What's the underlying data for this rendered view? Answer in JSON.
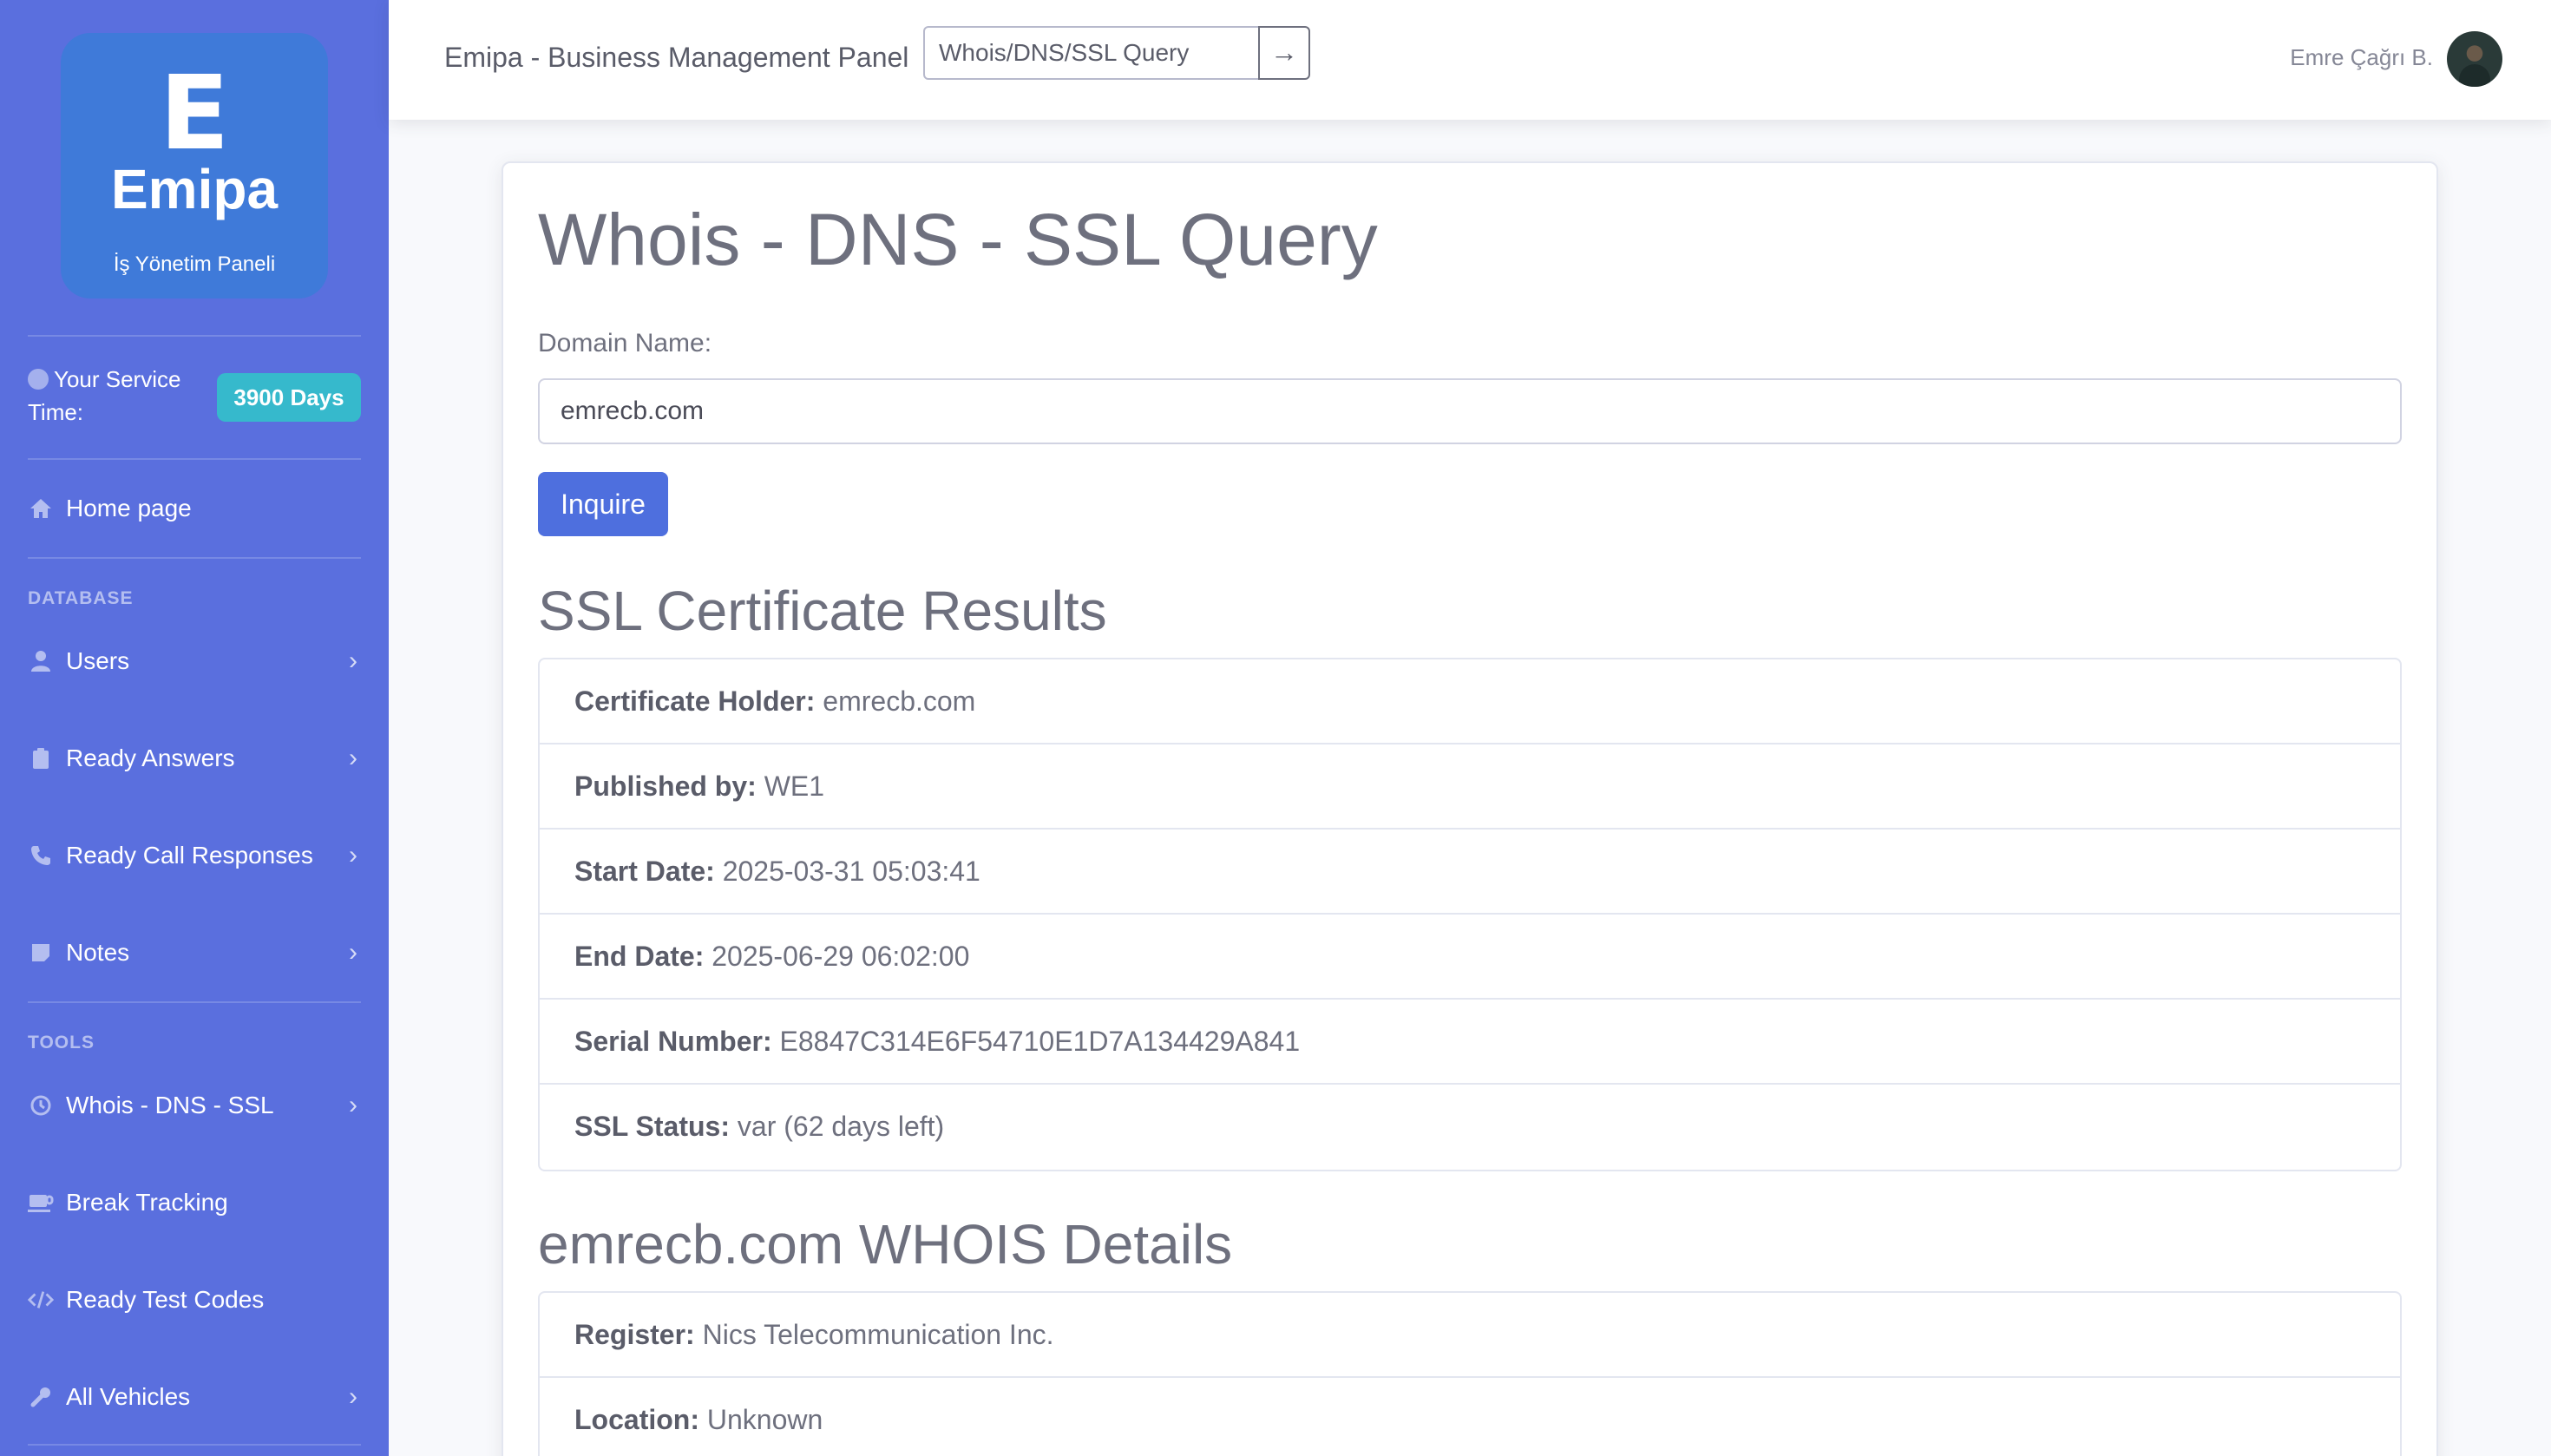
{
  "sidebar": {
    "brand": {
      "letter": "E",
      "name": "Emipa",
      "subtitle": "İş Yönetim Paneli"
    },
    "service": {
      "label": "Your Service Time:",
      "badge": "3900 Days"
    },
    "home": "Home page",
    "database_heading": "DATABASE",
    "database_items": [
      {
        "label": "Users",
        "icon": "user-icon"
      },
      {
        "label": "Ready Answers",
        "icon": "clipboard-icon"
      },
      {
        "label": "Ready Call Responses",
        "icon": "phone-icon"
      },
      {
        "label": "Notes",
        "icon": "sticky-note-icon"
      }
    ],
    "tools_heading": "TOOLS",
    "tools_items": [
      {
        "label": "Whois - DNS - SSL",
        "icon": "history-icon"
      },
      {
        "label": "Break Tracking",
        "icon": "coffee-icon"
      },
      {
        "label": "Ready Test Codes",
        "icon": "code-icon"
      },
      {
        "label": "All Vehicles",
        "icon": "wrench-icon"
      }
    ]
  },
  "topbar": {
    "title": "Emipa - Business Management Panel",
    "search_value": "Whois/DNS/SSL Query",
    "go_icon": "arrow-right-icon",
    "user_name": "Emre Çağrı B."
  },
  "main": {
    "heading": "Whois - DNS - SSL Query",
    "domain_label": "Domain Name:",
    "domain_value": "emrecb.com",
    "submit_label": "Inquire",
    "ssl_heading": "SSL Certificate Results",
    "ssl_rows": [
      {
        "key": "Certificate Holder:",
        "value": "emrecb.com"
      },
      {
        "key": "Published by:",
        "value": "WE1"
      },
      {
        "key": "Start Date:",
        "value": "2025-03-31 05:03:41"
      },
      {
        "key": "End Date:",
        "value": "2025-06-29 06:02:00"
      },
      {
        "key": "Serial Number:",
        "value": "E8847C314E6F54710E1D7A134429A841"
      },
      {
        "key": "SSL Status:",
        "value": "var (62 days left)"
      }
    ],
    "whois_heading": "emrecb.com WHOIS Details",
    "whois_rows": [
      {
        "key": "Register:",
        "value": "Nics Telecommunication Inc."
      },
      {
        "key": "Location:",
        "value": "Unknown"
      }
    ]
  },
  "colors": {
    "sidebar": "#5a6fde",
    "brand_tile": "#3f7ad9",
    "badge": "#36b9cc",
    "primary_button": "#4e6fde"
  }
}
